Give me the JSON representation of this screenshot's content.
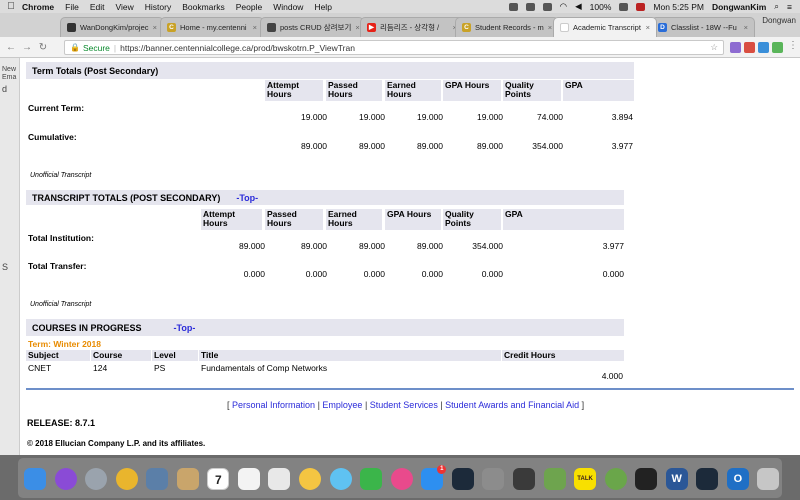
{
  "menubar": {
    "app": "Chrome",
    "menus": [
      "File",
      "Edit",
      "View",
      "History",
      "Bookmarks",
      "People",
      "Window",
      "Help"
    ],
    "battery": "100%",
    "clock": "Mon 5:25 PM",
    "user": "DongwanKim"
  },
  "tabs": [
    {
      "label": "WanDongKim/projec",
      "color": "#333333",
      "glyph": ""
    },
    {
      "label": "Home - my.centenni",
      "color": "#c9a227",
      "glyph": "C"
    },
    {
      "label": "posts CRUD 삼려보기",
      "color": "#444444",
      "glyph": ""
    },
    {
      "label": "리듬리즈 - 상각형 /",
      "color": "#e62117",
      "glyph": "▶"
    },
    {
      "label": "Student Records - m",
      "color": "#c9a227",
      "glyph": "C"
    },
    {
      "label": "Academic Transcript",
      "color": "#ffffff",
      "glyph": ""
    },
    {
      "label": "Classlist - 18W --Fu",
      "color": "#2a6dd8",
      "glyph": "D"
    }
  ],
  "profile_name": "Dongwan",
  "omnibox": {
    "secure_label": "Secure",
    "url": "https://banner.centennialcollege.ca/prod/bwskotrn.P_ViewTran"
  },
  "sidebar_letters": [
    "New",
    "Ema",
    "d",
    "S"
  ],
  "term_totals": {
    "title": "Term Totals (Post Secondary)",
    "headers": [
      "Attempt Hours",
      "Passed Hours",
      "Earned Hours",
      "GPA Hours",
      "Quality Points",
      "GPA"
    ],
    "rows": [
      {
        "label": "Current Term:",
        "values": [
          "19.000",
          "19.000",
          "19.000",
          "19.000",
          "74.000",
          "3.894"
        ]
      },
      {
        "label": "Cumulative:",
        "values": [
          "89.000",
          "89.000",
          "89.000",
          "89.000",
          "354.000",
          "3.977"
        ]
      }
    ]
  },
  "unofficial": "Unofficial Transcript",
  "transcript_totals": {
    "title": "TRANSCRIPT TOTALS (POST SECONDARY)",
    "top_link": "-Top-",
    "headers": [
      "Attempt Hours",
      "Passed Hours",
      "Earned Hours",
      "GPA Hours",
      "Quality Points",
      "GPA"
    ],
    "rows": [
      {
        "label": "Total Institution:",
        "values": [
          "89.000",
          "89.000",
          "89.000",
          "89.000",
          "354.000",
          "3.977"
        ]
      },
      {
        "label": "Total Transfer:",
        "values": [
          "0.000",
          "0.000",
          "0.000",
          "0.000",
          "0.000",
          "0.000"
        ]
      }
    ]
  },
  "courses": {
    "title": "COURSES IN PROGRESS",
    "top_link": "-Top-",
    "term": "Term: Winter 2018",
    "headers": [
      "Subject",
      "Course",
      "Level",
      "Title",
      "Credit Hours"
    ],
    "row": {
      "subject": "CNET",
      "course": "124",
      "level": "PS",
      "title": "Fundamentals of Comp Networks",
      "credit_hours": "4.000"
    }
  },
  "footer": {
    "links": [
      "Personal Information",
      "Employee",
      "Student Services",
      "Student Awards and Financial Aid"
    ],
    "release": "RELEASE: 8.7.1",
    "copyright": "© 2018 Ellucian Company L.P. and its affiliates."
  },
  "dock_date": "7",
  "dock_badge": "1",
  "dock_kakao": "TALK",
  "dock_word": "W",
  "dock_outlook": "O",
  "dock_icons": [
    {
      "name": "finder-icon",
      "color": "#3b8ee6"
    },
    {
      "name": "siri-icon",
      "color": "#8a4bd6",
      "round": true
    },
    {
      "name": "launchpad-icon",
      "color": "#9aa3ad",
      "round": true
    },
    {
      "name": "chrome-icon",
      "color": "#e9b52d",
      "round": true
    },
    {
      "name": "preview-icon",
      "color": "#5b7fa8"
    },
    {
      "name": "notes-icon",
      "color": "#c9a56b"
    },
    {
      "name": "calendar-icon",
      "color": "#ffffff"
    },
    {
      "name": "stickies-icon",
      "color": "#f3f3f3"
    },
    {
      "name": "textedit-icon",
      "color": "#e8e8e8"
    },
    {
      "name": "photos-icon",
      "color": "#f4c542",
      "round": true
    },
    {
      "name": "messages-icon",
      "color": "#5fc2f2",
      "round": true
    },
    {
      "name": "facetime-icon",
      "color": "#3bb54a"
    },
    {
      "name": "itunes-icon",
      "color": "#e94a8c",
      "round": true
    },
    {
      "name": "appstore-icon",
      "color": "#2d8ff0"
    },
    {
      "name": "league-icon",
      "color": "#1c2a3a"
    },
    {
      "name": "sysprefs-icon",
      "color": "#8c8c8c"
    },
    {
      "name": "sublime-icon",
      "color": "#3a3a3a"
    },
    {
      "name": "android-icon",
      "color": "#6ea44e"
    },
    {
      "name": "kakaotalk-icon",
      "color": "#f8e000"
    },
    {
      "name": "stoplight-icon",
      "color": "#6aa64a",
      "round": true
    },
    {
      "name": "terminal-icon",
      "color": "#222222"
    },
    {
      "name": "word-icon",
      "color": "#2b5797"
    },
    {
      "name": "league2-icon",
      "color": "#1c2a3a"
    },
    {
      "name": "outlook-icon",
      "color": "#1f6fc5"
    },
    {
      "name": "trash-icon",
      "color": "#c6c6c6"
    }
  ]
}
